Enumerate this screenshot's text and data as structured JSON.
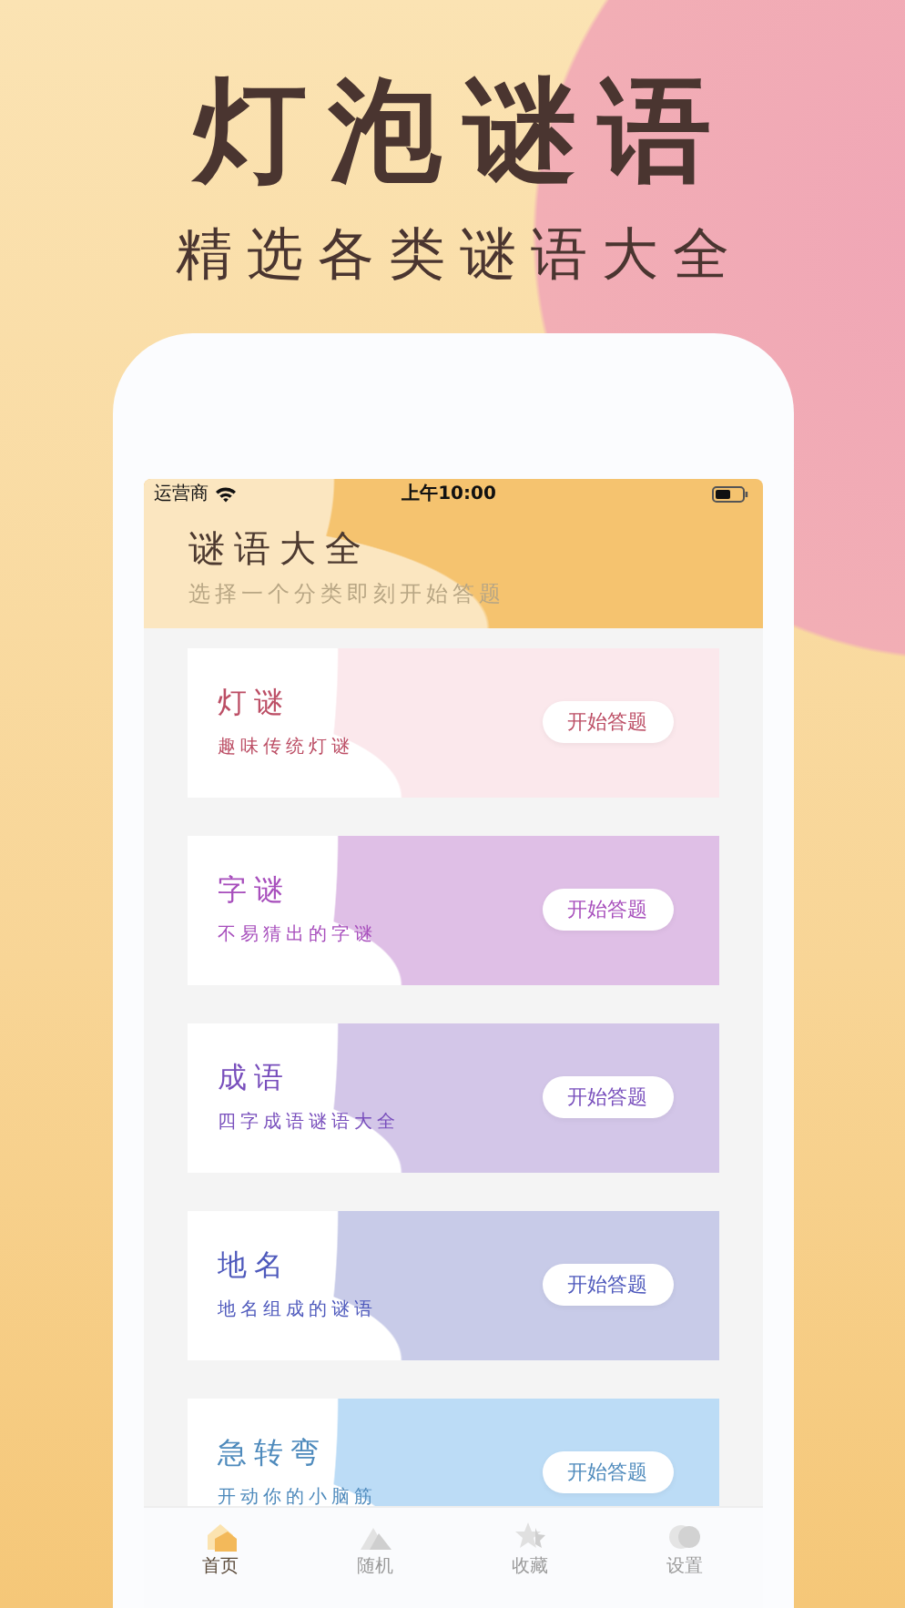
{
  "headline": "灯泡谜语",
  "tagline": "精选各类谜语大全",
  "status_bar": {
    "carrier": "运营商",
    "time": "上午10:00"
  },
  "header": {
    "title": "谜语大全",
    "subtitle": "选择一个分类即刻开始答题"
  },
  "categories": [
    {
      "title": "灯谜",
      "subtitle": "趣味传统灯谜",
      "button": "开始答题",
      "color": "#fbe8ec"
    },
    {
      "title": "字谜",
      "subtitle": "不易猜出的字谜",
      "button": "开始答题",
      "color": "#dfbfe6"
    },
    {
      "title": "成语",
      "subtitle": "四字成语谜语大全",
      "button": "开始答题",
      "color": "#d3c6e8"
    },
    {
      "title": "地名",
      "subtitle": "地名组成的谜语",
      "button": "开始答题",
      "color": "#c8cbe8"
    },
    {
      "title": "急转弯",
      "subtitle": "开动你的小脑筋",
      "button": "开始答题",
      "color": "#bcdcf6"
    }
  ],
  "tabs": [
    {
      "kind": "home",
      "label": "首页",
      "selected": true
    },
    {
      "kind": "random",
      "label": "随机",
      "selected": false
    },
    {
      "kind": "favorites",
      "label": "收藏",
      "selected": false
    },
    {
      "kind": "settings",
      "label": "设置",
      "selected": false
    }
  ]
}
